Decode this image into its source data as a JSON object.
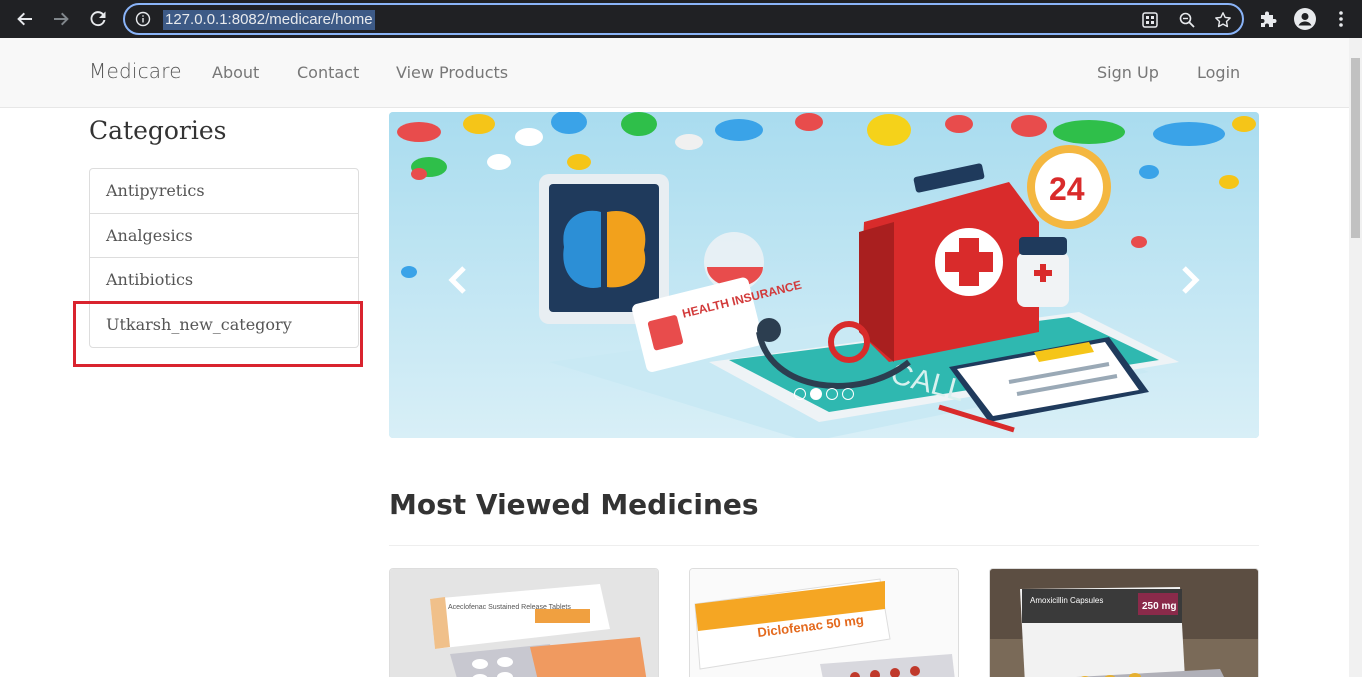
{
  "browser": {
    "url": "127.0.0.1:8082/medicare/home"
  },
  "navbar": {
    "brand": "Medicare",
    "links": [
      "About",
      "Contact",
      "View Products"
    ],
    "right_links": [
      "Sign Up",
      "Login"
    ]
  },
  "sidebar": {
    "title": "Categories",
    "items": [
      "Antipyretics",
      "Analgesics",
      "Antibiotics",
      "Utkarsh_new_category"
    ]
  },
  "carousel": {
    "slides": 4,
    "active_slide": 2,
    "image_text": [
      "HEALTH INSURANCE",
      "24",
      "CALL"
    ]
  },
  "section": {
    "title": "Most Viewed Medicines"
  },
  "products": [
    {
      "label": "Aceclofenac Sustained Release Tablets"
    },
    {
      "label": "Diclofenac 50 mg"
    },
    {
      "label": "Amoxicillin Capsules",
      "dose": "250 mg"
    }
  ],
  "colors": {
    "highlight": "#d9232e",
    "chrome": "#202124",
    "focus_ring": "#8ab4f8"
  }
}
